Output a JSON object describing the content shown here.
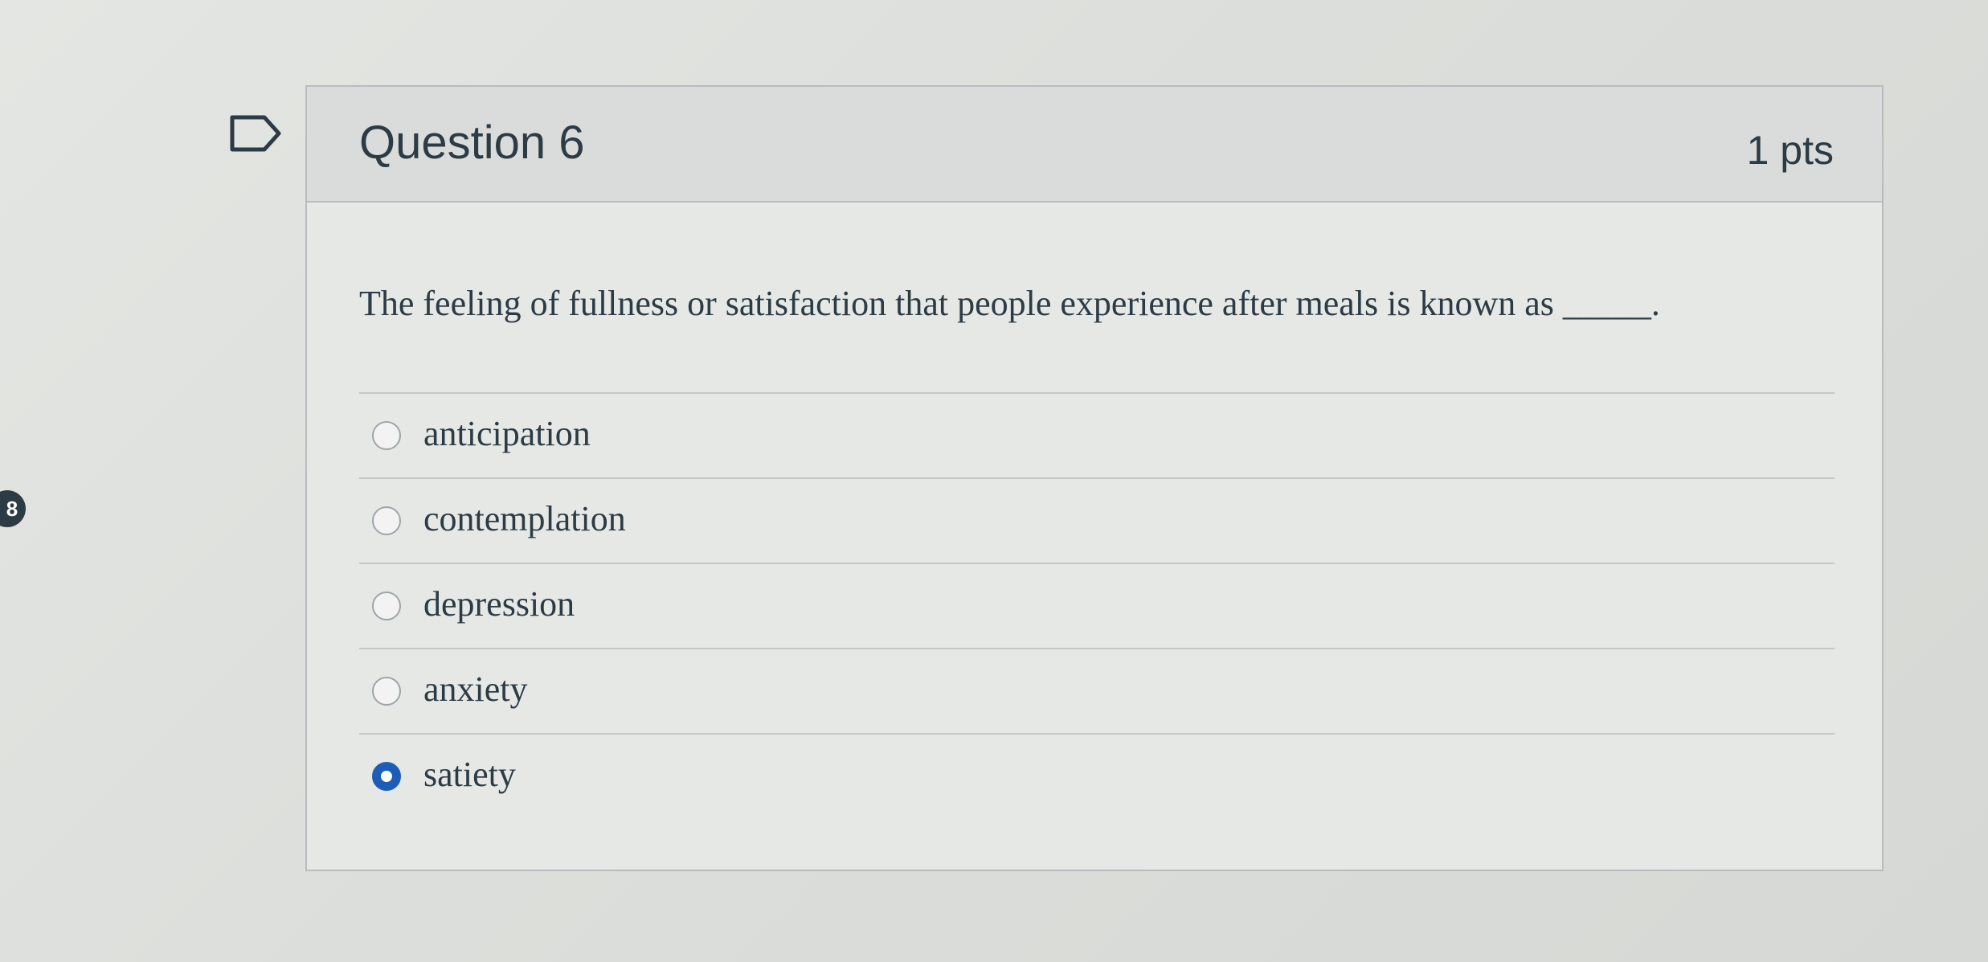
{
  "question": {
    "title": "Question 6",
    "points": "1 pts",
    "text": "The feeling of fullness or satisfaction that people experience after meals is known as _____.",
    "answers": [
      {
        "label": "anticipation",
        "selected": false
      },
      {
        "label": "contemplation",
        "selected": false
      },
      {
        "label": "depression",
        "selected": false
      },
      {
        "label": "anxiety",
        "selected": false
      },
      {
        "label": "satiety",
        "selected": true
      }
    ]
  },
  "side_badge": "8",
  "icons": {
    "flag": "flag-question-icon"
  },
  "colors": {
    "text": "#2d3b45",
    "selected_radio": "#1d5db5",
    "header_bg": "#d9dcda"
  }
}
